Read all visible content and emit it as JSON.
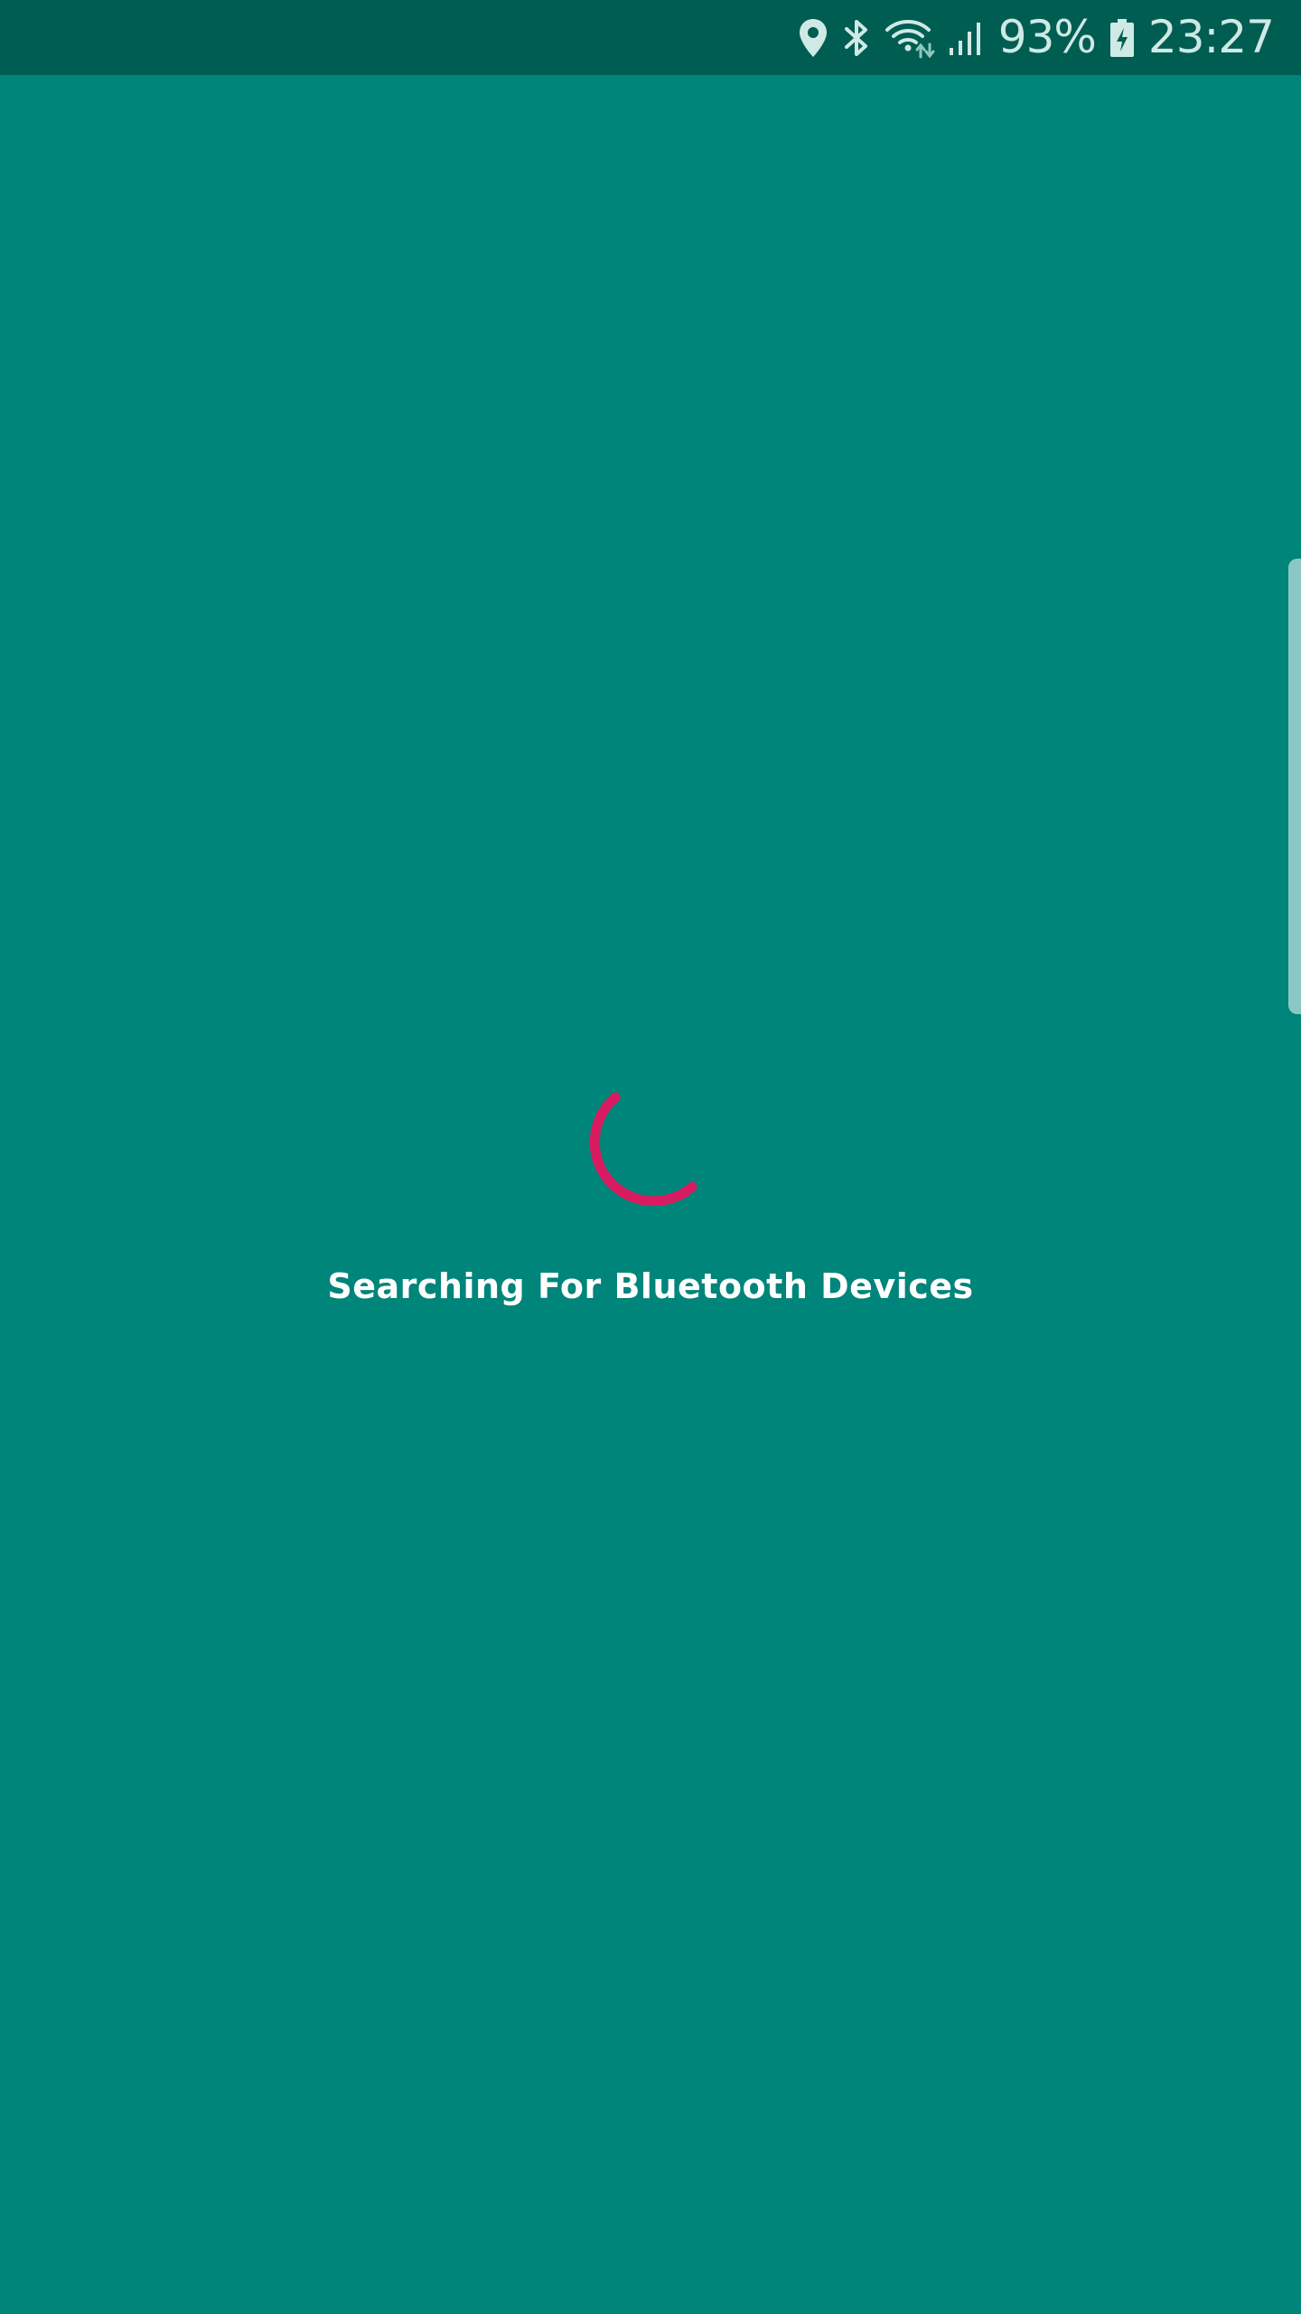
{
  "status_bar": {
    "battery_percent": "93%",
    "time": "23:27",
    "icons": [
      "location-icon",
      "bluetooth-icon",
      "wifi-icon",
      "signal-icon",
      "battery-charging-icon"
    ]
  },
  "main": {
    "message": "Searching For Bluetooth Devices"
  },
  "colors": {
    "background": "#00857A",
    "status_bar": "#005D52",
    "spinner": "#D81B60",
    "text": "#FFFFFF"
  }
}
